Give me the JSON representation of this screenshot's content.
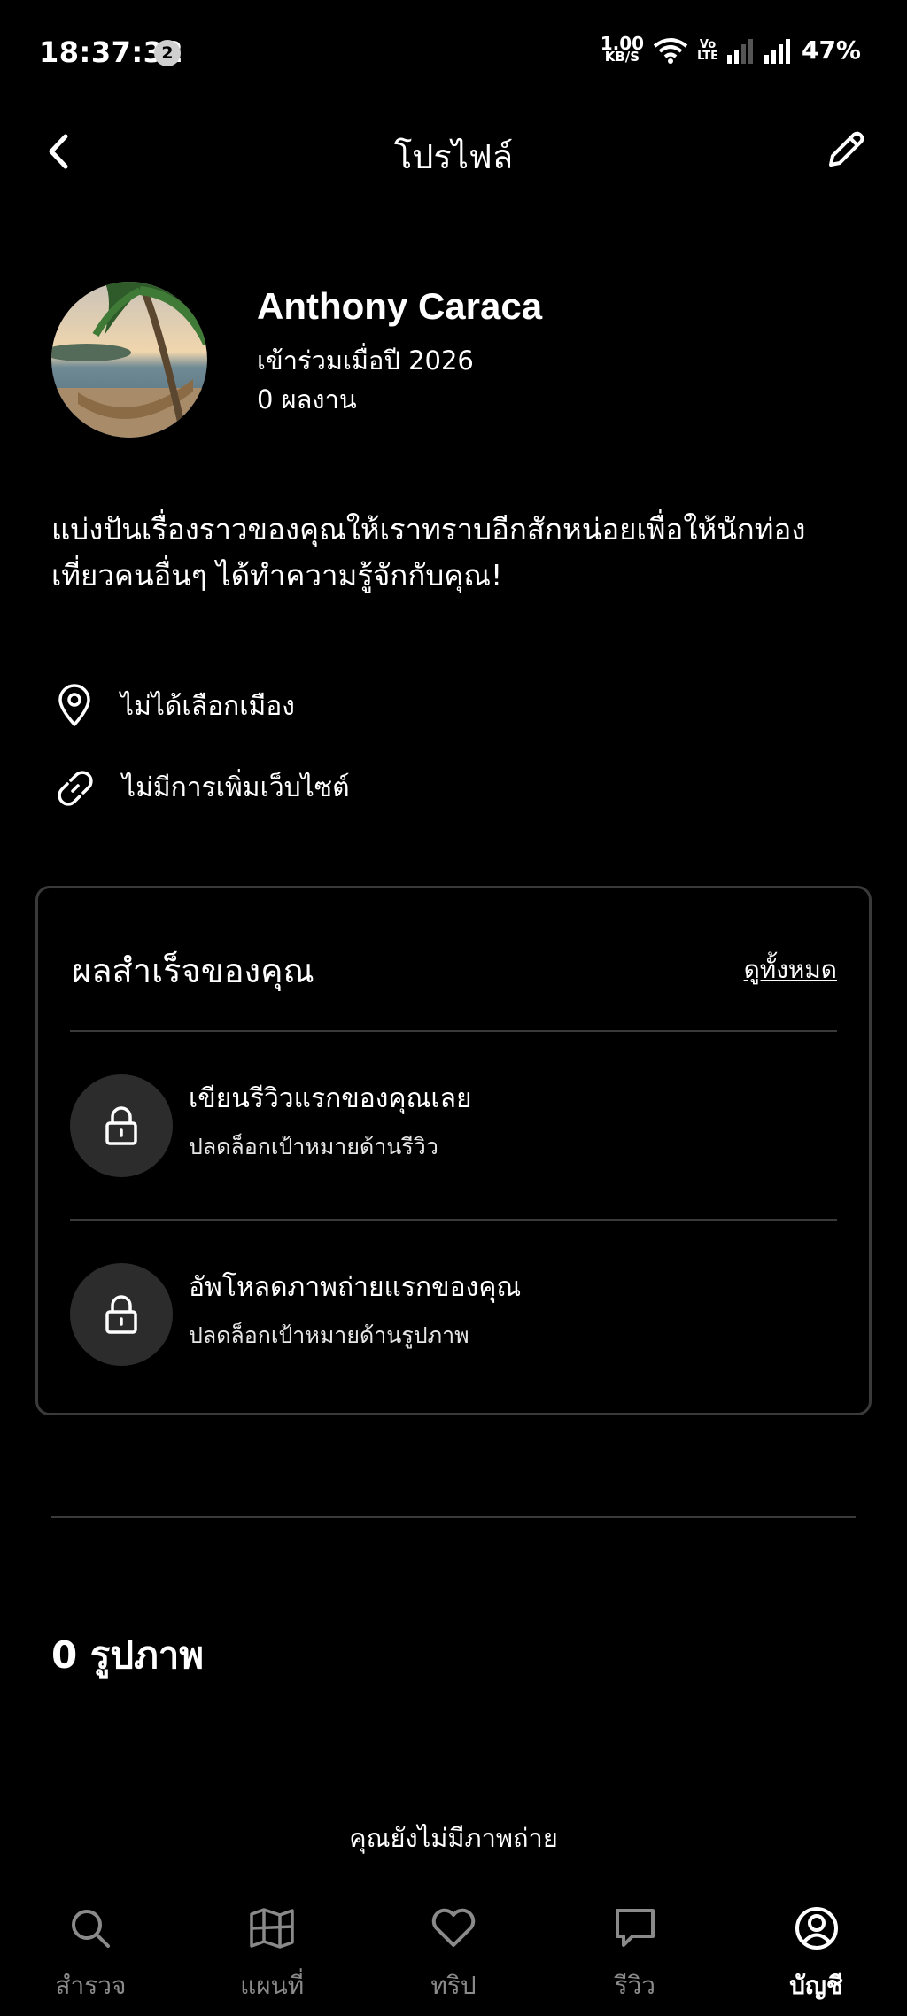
{
  "status_bar": {
    "time": "18:37:32",
    "notification_count": "2",
    "net_speed_value": "1.00",
    "net_speed_unit": "KB/S",
    "volte_top": "Vo",
    "volte_bottom": "LTE",
    "battery": "47%"
  },
  "header": {
    "title": "โปรไฟล์",
    "back_icon": "chevron-left-icon",
    "edit_icon": "pencil-icon"
  },
  "profile": {
    "name": "Anthony Caraca",
    "joined": "เข้าร่วมเมื่อปี 2026",
    "works": "0 ผลงาน",
    "bio": "แบ่งปันเรื่องราวของคุณให้เราทราบอีกสักหน่อยเพื่อให้นักท่องเที่ยวคนอื่นๆ ได้ทำความรู้จักกับคุณ!",
    "city": "ไม่ได้เลือกเมือง",
    "website": "ไม่มีการเพิ่มเว็บไซต์"
  },
  "achievements": {
    "title": "ผลสำเร็จของคุณ",
    "view_all": "ดูทั้งหมด",
    "items": [
      {
        "title": "เขียนรีวิวแรกของคุณเลย",
        "subtitle": "ปลดล็อกเป้าหมายด้านรีวิว",
        "icon": "lock-icon"
      },
      {
        "title": "อัพโหลดภาพถ่ายแรกของคุณ",
        "subtitle": "ปลดล็อกเป้าหมายด้านรูปภาพ",
        "icon": "lock-icon"
      }
    ]
  },
  "photos": {
    "heading": "0 รูปภาพ",
    "empty": "คุณยังไม่มีภาพถ่าย"
  },
  "bottom_nav": [
    {
      "label": "สำรวจ",
      "icon": "search-icon",
      "active": false
    },
    {
      "label": "แผนที่",
      "icon": "map-icon",
      "active": false
    },
    {
      "label": "ทริป",
      "icon": "heart-icon",
      "active": false
    },
    {
      "label": "รีวิว",
      "icon": "chat-bubble-icon",
      "active": false
    },
    {
      "label": "บัญชี",
      "icon": "account-icon",
      "active": true
    }
  ],
  "colors": {
    "background": "#000000",
    "text": "#ffffff",
    "muted": "#8a8a8a",
    "divider": "#3a3a3a",
    "icon_circle": "#2c2c2c"
  }
}
